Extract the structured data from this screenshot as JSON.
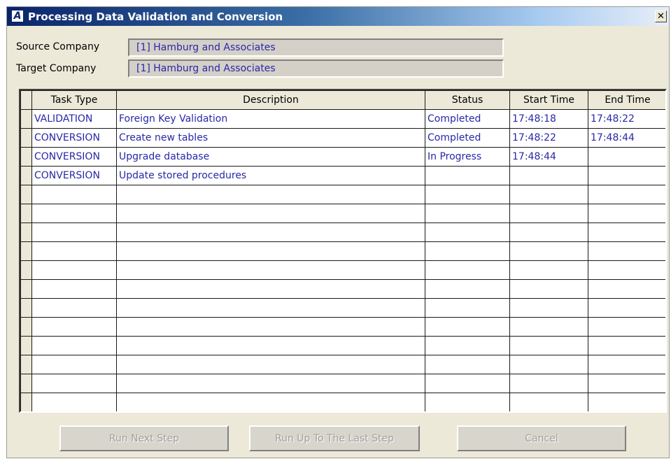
{
  "window": {
    "title": "Processing Data Validation and Conversion",
    "close_glyph": "✕",
    "app_icon_letter": "A"
  },
  "form": {
    "source_label": "Source Company",
    "source_value": "[1] Hamburg and Associates",
    "target_label": "Target Company",
    "target_value": "[1] Hamburg and Associates"
  },
  "table": {
    "columns": [
      "Task Type",
      "Description",
      "Status",
      "Start Time",
      "End Time"
    ],
    "rows": [
      [
        "VALIDATION",
        "Foreign Key Validation",
        "Completed",
        "17:48:18",
        "17:48:22"
      ],
      [
        "CONVERSION",
        "Create new tables",
        "Completed",
        "17:48:22",
        "17:48:44"
      ],
      [
        "CONVERSION",
        "Upgrade database",
        "In Progress",
        "17:48:44",
        ""
      ],
      [
        "CONVERSION",
        "Update stored procedures",
        "",
        "",
        ""
      ],
      [
        "",
        "",
        "",
        "",
        ""
      ],
      [
        "",
        "",
        "",
        "",
        ""
      ],
      [
        "",
        "",
        "",
        "",
        ""
      ],
      [
        "",
        "",
        "",
        "",
        ""
      ],
      [
        "",
        "",
        "",
        "",
        ""
      ],
      [
        "",
        "",
        "",
        "",
        ""
      ],
      [
        "",
        "",
        "",
        "",
        ""
      ],
      [
        "",
        "",
        "",
        "",
        ""
      ],
      [
        "",
        "",
        "",
        "",
        ""
      ],
      [
        "",
        "",
        "",
        "",
        ""
      ],
      [
        "",
        "",
        "",
        "",
        ""
      ],
      [
        "",
        "",
        "",
        "",
        ""
      ]
    ]
  },
  "buttons": {
    "run_next": "Run Next Step",
    "run_to_last": "Run Up To The Last Step",
    "cancel": "Cancel"
  },
  "colors": {
    "value_text": "#2828a8",
    "title_gradient_start": "#0a246a",
    "dialog_background": "#ece9d8"
  },
  "icons": {
    "app": "app-logo-icon",
    "close": "close-icon"
  }
}
